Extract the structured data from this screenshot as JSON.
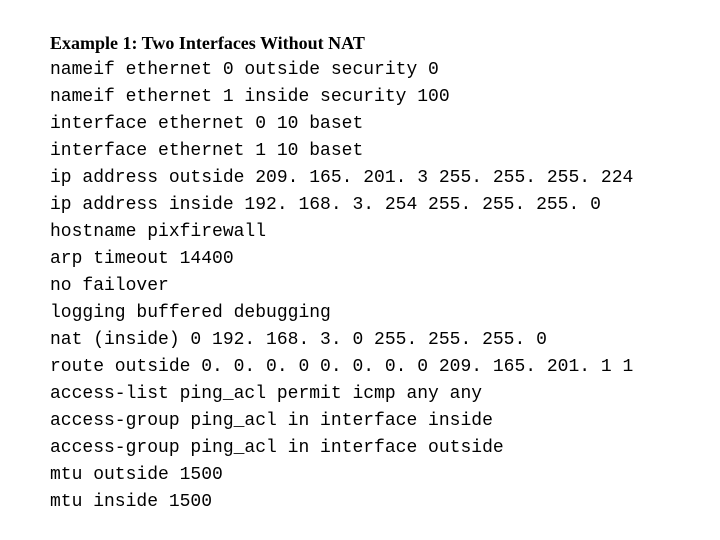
{
  "heading": "Example 1: Two Interfaces Without NAT",
  "lines": [
    "nameif ethernet 0 outside security 0",
    "nameif ethernet 1 inside security 100",
    "interface ethernet 0 10 baset",
    "interface ethernet 1 10 baset",
    "ip address outside 209. 165. 201. 3 255. 255. 255. 224",
    "ip address inside 192. 168. 3. 254 255. 255. 255. 0",
    "hostname pixfirewall",
    "arp timeout 14400",
    "no failover",
    "logging buffered debugging",
    "nat (inside) 0 192. 168. 3. 0 255. 255. 255. 0",
    "route outside 0. 0. 0. 0 0. 0. 0. 0 209. 165. 201. 1 1",
    "access-list ping_acl permit icmp any any",
    "access-group ping_acl in interface inside",
    "access-group ping_acl in interface outside",
    "mtu outside 1500",
    "mtu inside 1500"
  ]
}
